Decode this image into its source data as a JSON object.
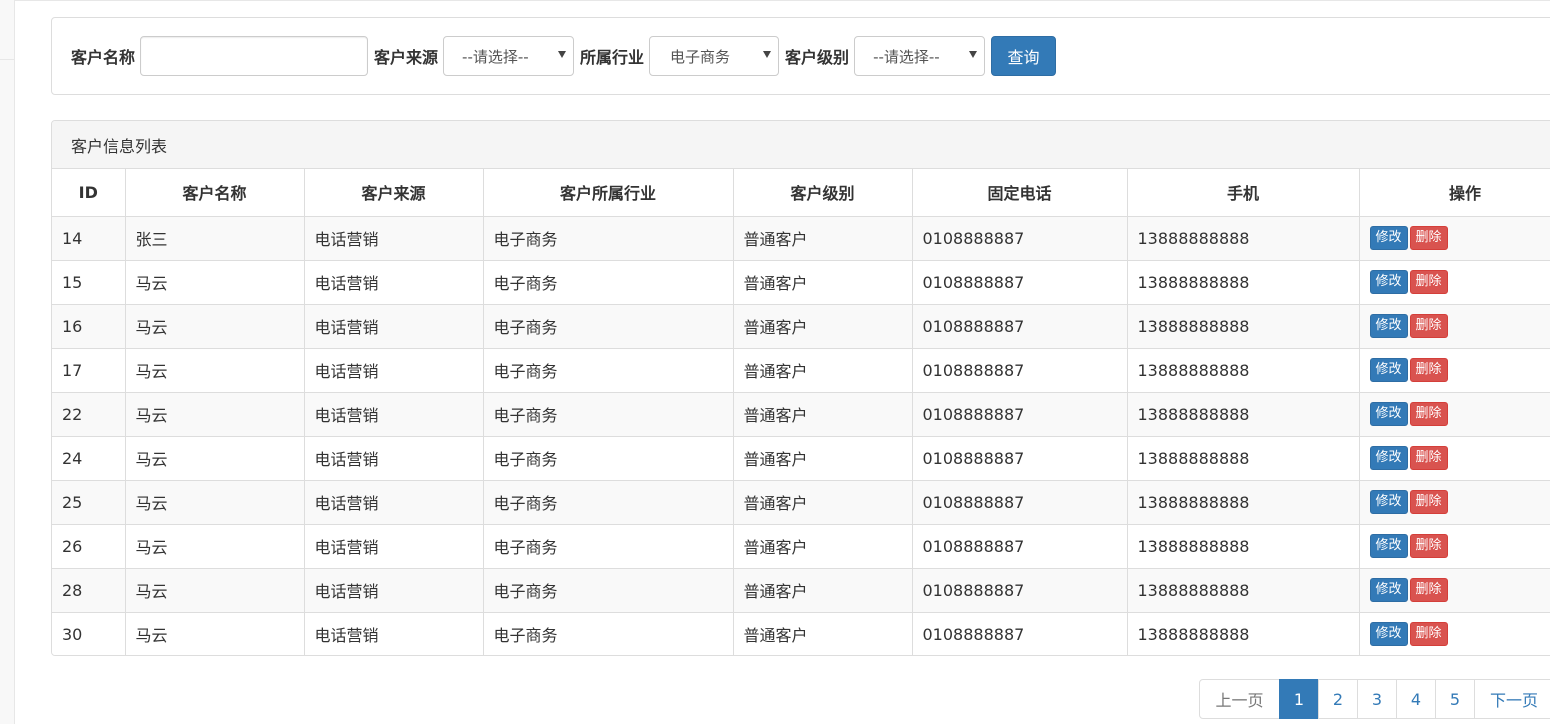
{
  "search": {
    "customer_name_label": "客户名称",
    "customer_name_value": "",
    "source_label": "客户来源",
    "source_selected": "--请选择--",
    "industry_label": "所属行业",
    "industry_selected": "电子商务",
    "level_label": "客户级别",
    "level_selected": "--请选择--",
    "query_button": "查询"
  },
  "list": {
    "title": "客户信息列表",
    "columns": [
      "ID",
      "客户名称",
      "客户来源",
      "客户所属行业",
      "客户级别",
      "固定电话",
      "手机",
      "操作"
    ],
    "rows": [
      {
        "id": "14",
        "name": "张三",
        "source": "电话营销",
        "industry": "电子商务",
        "level": "普通客户",
        "phone": "0108888887",
        "mobile": "13888888888"
      },
      {
        "id": "15",
        "name": "马云",
        "source": "电话营销",
        "industry": "电子商务",
        "level": "普通客户",
        "phone": "0108888887",
        "mobile": "13888888888"
      },
      {
        "id": "16",
        "name": "马云",
        "source": "电话营销",
        "industry": "电子商务",
        "level": "普通客户",
        "phone": "0108888887",
        "mobile": "13888888888"
      },
      {
        "id": "17",
        "name": "马云",
        "source": "电话营销",
        "industry": "电子商务",
        "level": "普通客户",
        "phone": "0108888887",
        "mobile": "13888888888"
      },
      {
        "id": "22",
        "name": "马云",
        "source": "电话营销",
        "industry": "电子商务",
        "level": "普通客户",
        "phone": "0108888887",
        "mobile": "13888888888"
      },
      {
        "id": "24",
        "name": "马云",
        "source": "电话营销",
        "industry": "电子商务",
        "level": "普通客户",
        "phone": "0108888887",
        "mobile": "13888888888"
      },
      {
        "id": "25",
        "name": "马云",
        "source": "电话营销",
        "industry": "电子商务",
        "level": "普通客户",
        "phone": "0108888887",
        "mobile": "13888888888"
      },
      {
        "id": "26",
        "name": "马云",
        "source": "电话营销",
        "industry": "电子商务",
        "level": "普通客户",
        "phone": "0108888887",
        "mobile": "13888888888"
      },
      {
        "id": "28",
        "name": "马云",
        "source": "电话营销",
        "industry": "电子商务",
        "level": "普通客户",
        "phone": "0108888887",
        "mobile": "13888888888"
      },
      {
        "id": "30",
        "name": "马云",
        "source": "电话营销",
        "industry": "电子商务",
        "level": "普通客户",
        "phone": "0108888887",
        "mobile": "13888888888"
      }
    ],
    "edit_label": "修改",
    "delete_label": "删除"
  },
  "pagination": {
    "prev": "上一页",
    "pages": [
      "1",
      "2",
      "3",
      "4",
      "5"
    ],
    "active_page": "1",
    "next": "下一页"
  },
  "colors": {
    "primary": "#337ab7",
    "danger": "#d9534f",
    "border": "#dddddd",
    "heading_bg": "#f5f5f5",
    "stripe_bg": "#f9f9f9"
  }
}
